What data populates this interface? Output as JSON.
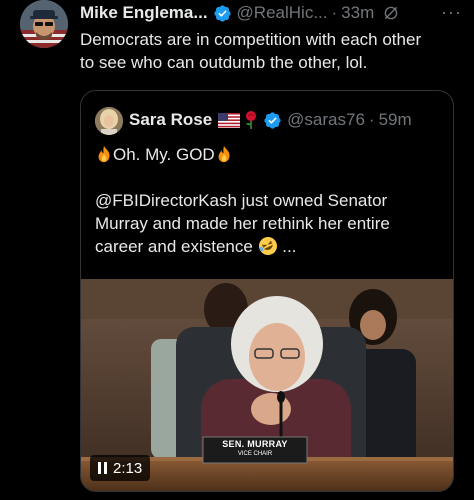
{
  "tweet": {
    "author_name": "Mike Englema...",
    "author_handle": "@RealHic...",
    "separator": "·",
    "timestamp": "33m",
    "more_label": "···",
    "text_line1": "Democrats are in competition with each other",
    "text_line2": "to see who can outdumb the other, lol."
  },
  "quote": {
    "author_name": "Sara Rose",
    "author_handle": "@saras76",
    "separator": "·",
    "timestamp": "59m",
    "heading_text": "Oh. My. GOD",
    "body_line1": "@FBIDirectorKash just owned Senator",
    "body_line2": "Murray and made her rethink her entire",
    "body_line3": "career and existence",
    "ellipsis": "...",
    "video": {
      "duration": "2:13",
      "nameplate_name": "SEN. MURRAY",
      "nameplate_title": "VICE CHAIR"
    }
  },
  "colors": {
    "background": "#000000",
    "text": "#e7e9ea",
    "secondary": "#71767b",
    "verified": "#1d9bf0",
    "border": "#2f3336"
  },
  "icons": [
    "verified-badge-icon",
    "grok-icon",
    "more-icon",
    "us-flag-icon",
    "rose-icon",
    "fire-icon",
    "rofl-icon",
    "pause-icon"
  ]
}
